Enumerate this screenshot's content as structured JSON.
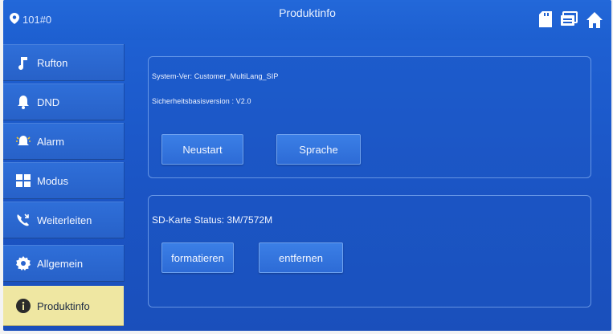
{
  "header": {
    "room": "101#0",
    "title": "Produktinfo"
  },
  "sidebar": {
    "items": [
      {
        "label": "Rufton",
        "icon": "music-note-icon"
      },
      {
        "label": "DND",
        "icon": "bell-icon"
      },
      {
        "label": "Alarm",
        "icon": "alarm-bell-icon"
      },
      {
        "label": "Modus",
        "icon": "grid-icon"
      },
      {
        "label": "Weiterleiten",
        "icon": "call-forward-icon"
      },
      {
        "label": "Allgemein",
        "icon": "gear-icon"
      },
      {
        "label": "Produktinfo",
        "icon": "info-icon",
        "active": true
      }
    ]
  },
  "system": {
    "version": "System-Ver: Customer_MultiLang_SIP",
    "security": "Sicherheitsbasisversion : V2.0",
    "restart_label": "Neustart",
    "language_label": "Sprache"
  },
  "sd": {
    "status": "SD-Karte Status: 3M/7572M",
    "format_label": "formatieren",
    "remove_label": "entfernen"
  },
  "colors": {
    "background": "#1b55c5",
    "active_item": "#efe7a2",
    "button": "#2d6bd6"
  }
}
